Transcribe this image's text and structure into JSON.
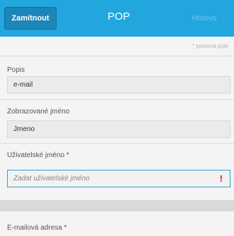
{
  "titlebar": {
    "left_button": "Zamítnout",
    "title": "POP",
    "right_button": "Hotovo"
  },
  "form": {
    "required_note": "* povinná pole",
    "fields": [
      {
        "label": "Popis",
        "value": "e-mail"
      },
      {
        "label": "Zobrazované jméno",
        "value": "Jmeno"
      },
      {
        "label": "Uživatelské jméno *",
        "placeholder": "Zadat uživatelské jméno",
        "error_icon": "!"
      }
    ],
    "next_label": "E-mailová adresa *"
  },
  "colors": {
    "titlebar": "#22a6de",
    "reject_button": "#1d86b8",
    "error": "#d21b1b",
    "focus_border": "#28a3d9"
  }
}
